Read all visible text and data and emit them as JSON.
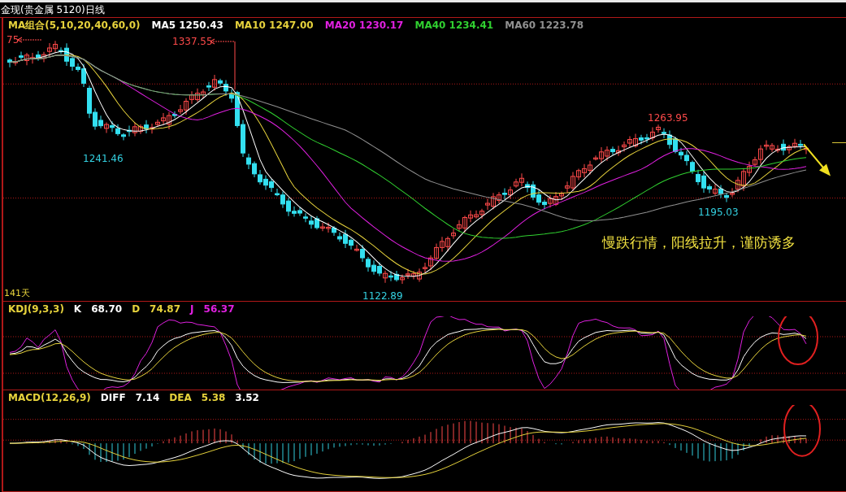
{
  "window": {
    "title": "金现(贵金属 5120)日线"
  },
  "price_panel": {
    "legend": [
      {
        "label": "MA组合(5,10,20,40,60,0)",
        "color": "#e6d23c"
      },
      {
        "label": "MA5 1250.43",
        "color": "#ffffff"
      },
      {
        "label": "MA10 1247.00",
        "color": "#e6d23c"
      },
      {
        "label": "MA20 1230.17",
        "color": "#e020e0"
      },
      {
        "label": "MA40 1234.41",
        "color": "#30d030"
      },
      {
        "label": "MA60 1223.78",
        "color": "#909090"
      }
    ],
    "price_labels": [
      {
        "text": "75",
        "kind": "high"
      },
      {
        "text": "1337.55",
        "kind": "high"
      },
      {
        "text": "1241.46",
        "kind": "low"
      },
      {
        "text": "1122.89",
        "kind": "low"
      },
      {
        "text": "1263.95",
        "kind": "high"
      },
      {
        "text": "1195.03",
        "kind": "low"
      }
    ],
    "days": "141天",
    "note": "慢跌行情，阳线拉升，谨防诱多"
  },
  "kdj_panel": {
    "legend": [
      {
        "label": "KDJ(9,3,3)",
        "color": "#e6d23c"
      },
      {
        "label": "K",
        "color": "#ffffff"
      },
      {
        "label": "68.70",
        "color": "#ffffff"
      },
      {
        "label": "D",
        "color": "#e6d23c"
      },
      {
        "label": "74.87",
        "color": "#e6d23c"
      },
      {
        "label": "J",
        "color": "#e020e0"
      },
      {
        "label": "56.37",
        "color": "#e020e0"
      }
    ]
  },
  "macd_panel": {
    "legend": [
      {
        "label": "MACD(12,26,9)",
        "color": "#e6d23c"
      },
      {
        "label": "DIFF",
        "color": "#ffffff"
      },
      {
        "label": "7.14",
        "color": "#ffffff"
      },
      {
        "label": "DEA",
        "color": "#e6d23c"
      },
      {
        "label": "5.38",
        "color": "#e6d23c"
      },
      {
        "label": "3.52",
        "color": "#ffffff"
      }
    ]
  }
}
